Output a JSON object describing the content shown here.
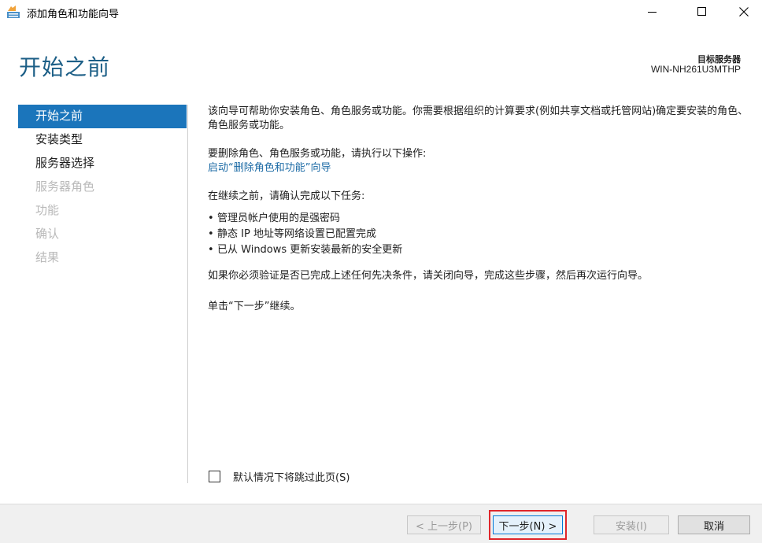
{
  "window": {
    "title": "添加角色和功能向导",
    "icons": [
      "wizard-app-icon",
      "minimize-icon",
      "maximize-icon",
      "close-icon"
    ]
  },
  "header": {
    "page_title": "开始之前",
    "target_server_label": "目标服务器",
    "target_server_name": "WIN-NH261U3MTHP"
  },
  "sidebar": {
    "items": [
      {
        "label": "开始之前",
        "state": "active"
      },
      {
        "label": "安装类型",
        "state": "enabled"
      },
      {
        "label": "服务器选择",
        "state": "enabled"
      },
      {
        "label": "服务器角色",
        "state": "disabled"
      },
      {
        "label": "功能",
        "state": "disabled"
      },
      {
        "label": "确认",
        "state": "disabled"
      },
      {
        "label": "结果",
        "state": "disabled"
      }
    ]
  },
  "content": {
    "intro": "该向导可帮助你安装角色、角色服务或功能。你需要根据组织的计算要求(例如共享文档或托管网站)确定要安装的角色、角色服务或功能。",
    "remove_heading": "要删除角色、角色服务或功能，请执行以下操作:",
    "remove_link": "启动“删除角色和功能”向导",
    "confirm_heading": "在继续之前，请确认完成以下任务:",
    "tasks": [
      "管理员帐户使用的是强密码",
      "静态 IP 地址等网络设置已配置完成",
      "已从 Windows 更新安装最新的安全更新"
    ],
    "verify_note": "如果你必须验证是否已完成上述任何先决条件，请关闭向导，完成这些步骤，然后再次运行向导。",
    "continue_note": "单击“下一步”继续。"
  },
  "skip_checkbox": {
    "label": "默认情况下将跳过此页(S)",
    "checked": false
  },
  "footer": {
    "prev_label": "< 上一步(P)",
    "next_label": "下一步(N) >",
    "install_label": "安装(I)",
    "cancel_label": "取消"
  },
  "colors": {
    "accent": "#1b75bb",
    "title": "#1b5e86",
    "link": "#1b6aa5",
    "highlight": "#e0262b"
  }
}
